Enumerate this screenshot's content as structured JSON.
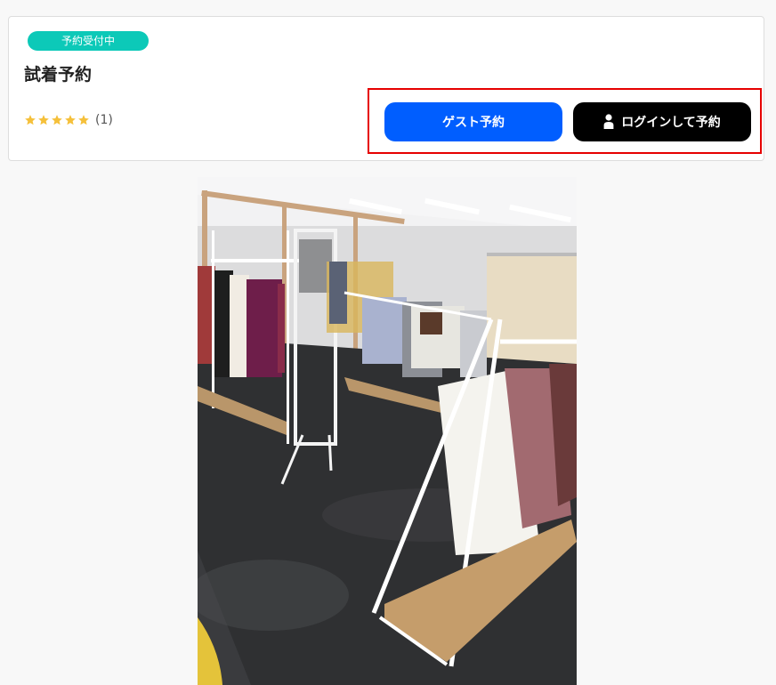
{
  "card": {
    "status_badge": "予約受付中",
    "title": "試着予約",
    "rating": {
      "stars": 5,
      "count_text": "(1)"
    }
  },
  "actions": {
    "guest_label": "ゲスト予約",
    "login_label": "ログインして予約"
  },
  "icons": {
    "star": "star-icon",
    "person": "person-icon"
  },
  "colors": {
    "badge": "#0cc9b8",
    "guest_button": "#005eff",
    "login_button": "#000000",
    "star": "#f5c03a",
    "highlight_border": "#e60000"
  }
}
